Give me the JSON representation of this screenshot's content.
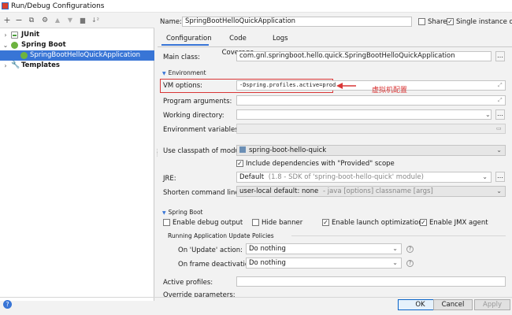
{
  "window": {
    "title": "Run/Debug Configurations"
  },
  "toolbar": {
    "icons": [
      "plus-icon",
      "minus-icon",
      "copy-icon",
      "settings-icon",
      "move-up-icon",
      "move-down-icon",
      "folder-icon",
      "sort-icon"
    ],
    "glyphs": [
      "+",
      "−",
      "⧉",
      "⚙",
      "▲",
      "▼",
      "▆",
      "↓²"
    ]
  },
  "tree": {
    "items": [
      {
        "label": "JUnit",
        "chevron": "›"
      },
      {
        "label": "Spring Boot",
        "chevron": "⌄"
      },
      {
        "label": "SpringBootHelloQuickApplication"
      },
      {
        "label": "Templates",
        "chevron": "›"
      }
    ]
  },
  "header": {
    "name_label": "Name:",
    "name_value": "SpringBootHelloQuickApplication",
    "share_label": "Share",
    "single_instance_label": "Single instance only"
  },
  "tabs": [
    {
      "label": "Configuration"
    },
    {
      "label": "Code Coverage"
    },
    {
      "label": "Logs"
    }
  ],
  "config": {
    "main_class_label": "Main class:",
    "main_class_value": "com.gnl.springboot.hello.quick.SpringBootHelloQuickApplication",
    "environment_section": "Environment",
    "vm_options_label": "VM options:",
    "vm_options_value": "-Dspring.profiles.active=prod",
    "vm_annotation": "虚拟机配置",
    "program_arguments_label": "Program arguments:",
    "working_directory_label": "Working directory:",
    "environment_variables_label": "Environment variables:",
    "classpath_label": "Use classpath of module:",
    "classpath_value": "spring-boot-hello-quick",
    "include_provided_label": "Include dependencies with \"Provided\" scope",
    "jre_label": "JRE:",
    "jre_value": "Default",
    "jre_hint": "(1.8 - SDK of 'spring-boot-hello-quick' module)",
    "shorten_label": "Shorten command line:",
    "shorten_value": "user-local default: none",
    "shorten_hint": "- java [options] classname [args]",
    "spring_boot_section": "Spring Boot",
    "enable_debug_label": "Enable debug output",
    "hide_banner_label": "Hide banner",
    "launch_optimization_label": "Enable launch optimization",
    "jmx_label": "Enable JMX agent",
    "update_policies_label": "Running Application Update Policies",
    "on_update_label": "On 'Update' action:",
    "on_update_value": "Do nothing",
    "on_frame_label": "On frame deactivation:",
    "on_frame_value": "Do nothing",
    "active_profiles_label": "Active profiles:",
    "override_parameters_label": "Override parameters:"
  },
  "footer": {
    "help": "?",
    "ok": "OK",
    "cancel": "Cancel",
    "apply": "Apply"
  },
  "colors": {
    "accent": "#3875d6",
    "annotation": "#d93636",
    "selection": "#3875d6"
  }
}
